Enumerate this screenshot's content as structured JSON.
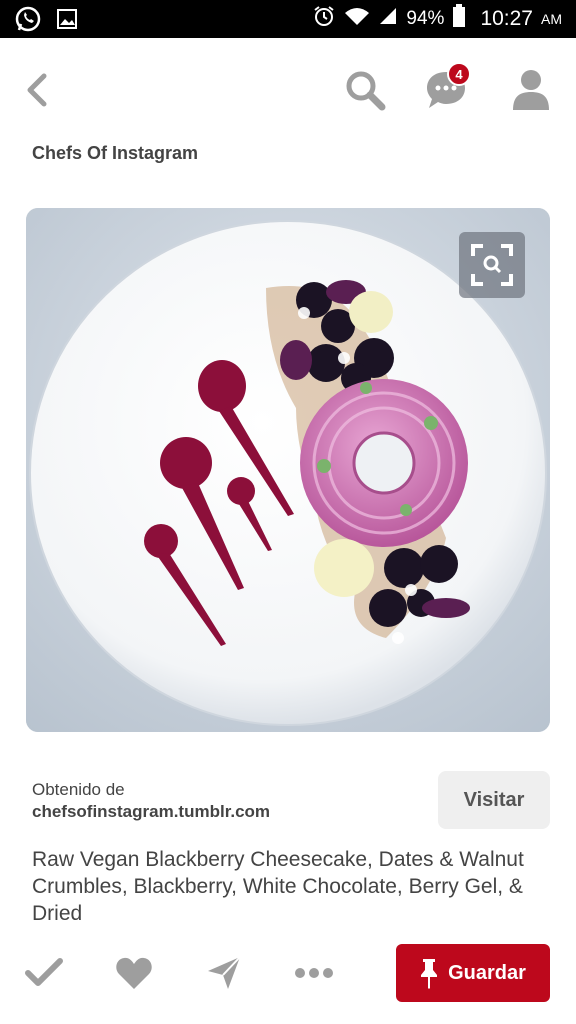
{
  "status_bar": {
    "battery": "94%",
    "time": "10:27",
    "ampm": "AM"
  },
  "header": {
    "notification_count": "4"
  },
  "board": {
    "title": "Chefs Of Instagram"
  },
  "source": {
    "label": "Obtenido de",
    "domain": "chefsofinstagram.tumblr.com",
    "visit_label": "Visitar"
  },
  "pin": {
    "description": "Raw Vegan Blackberry Cheesecake, Dates & Walnut Crumbles, Blackberry, White Chocolate, Berry Gel, & Dried"
  },
  "actions": {
    "save_label": "Guardar"
  },
  "colors": {
    "brand": "#bd081c",
    "icon_gray": "#9e9e9e"
  }
}
